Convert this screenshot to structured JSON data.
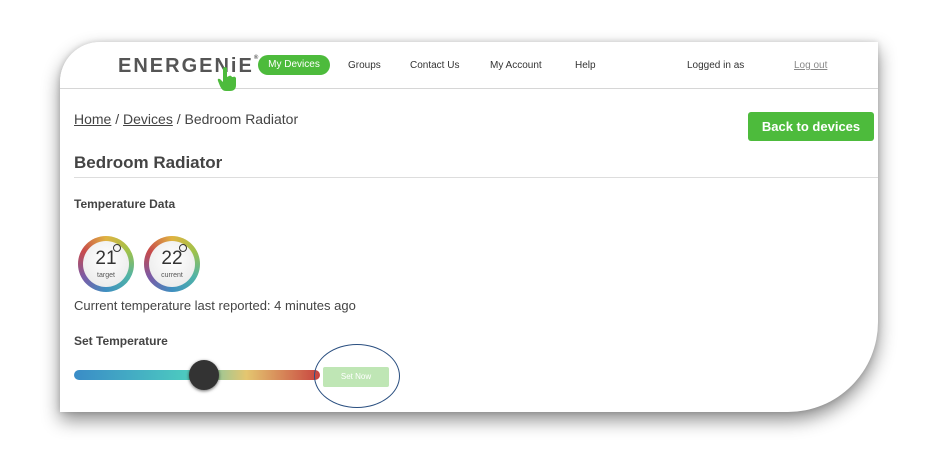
{
  "nav": {
    "logo": "ENERGEN",
    "logo_i": "i",
    "logo_end": "E",
    "logo_mark": "®",
    "my_devices": "My Devices",
    "groups": "Groups",
    "contact": "Contact Us",
    "account": "My Account",
    "help": "Help",
    "logged_in": "Logged in as",
    "logout": "Log out"
  },
  "breadcrumb": {
    "home": "Home",
    "sep1": " / ",
    "devices": "Devices",
    "sep2": " / ",
    "current": "Bedroom Radiator"
  },
  "back_button": "Back to devices",
  "page_title": "Bedroom Radiator",
  "temperature": {
    "heading": "Temperature Data",
    "target_value": "21",
    "target_label": "target",
    "current_value": "22",
    "current_label": "current",
    "last_reported": "Current temperature last reported: 4 minutes ago"
  },
  "set_temperature": {
    "heading": "Set Temperature",
    "slider_level": 0.53,
    "button": "Set Now"
  },
  "colors": {
    "accent_green": "#4dbb3c",
    "highlight_circle": "#2a4f80"
  },
  "icons": [
    "pointing-hand-icon"
  ]
}
